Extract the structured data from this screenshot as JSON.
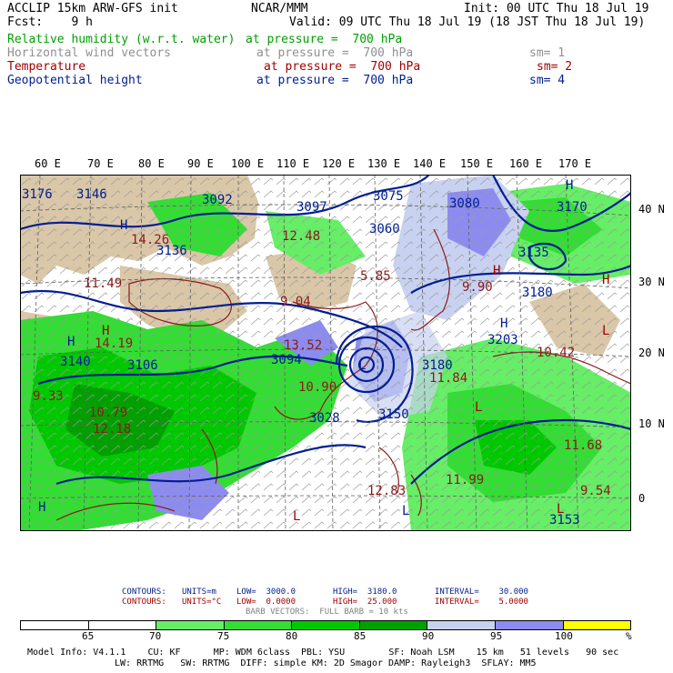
{
  "header": {
    "title": "ACCLIP 15km ARW-GFS init",
    "forecast": "Fcst:    9 h",
    "org": "NCAR/MMM",
    "init": "Init: 00 UTC Thu 18 Jul 19",
    "valid": "Valid: 09 UTC Thu 18 Jul 19 (18 JST Thu 18 Jul 19)"
  },
  "fields": [
    {
      "name": "Relative humidity (w.r.t. water)",
      "level": "at pressure =  700 hPa",
      "sm": "",
      "color": "#00a000"
    },
    {
      "name": "Horizontal wind vectors",
      "level": "at pressure =  700 hPa",
      "sm": "sm= 1",
      "color": "#909090"
    },
    {
      "name": "Temperature",
      "level": "at pressure =  700 hPa",
      "sm": "sm= 2",
      "color": "#a00000"
    },
    {
      "name": "Geopotential height",
      "level": "at pressure =  700 hPa",
      "sm": "sm= 4",
      "color": "#001e90"
    }
  ],
  "lon_labels": [
    "60 E",
    "70 E",
    "80 E",
    "90 E",
    "100 E",
    "110 E",
    "120 E",
    "130 E",
    "140 E",
    "150 E",
    "160 E",
    "170 E"
  ],
  "lat_labels": [
    "40 N",
    "30 N",
    "20 N",
    "10 N",
    "0"
  ],
  "height_labels": [
    "3176",
    "3146",
    "3092",
    "3097",
    "3075",
    "3080",
    "3060",
    "3170",
    "3136",
    "3135",
    "3180",
    "3203",
    "3094",
    "3140",
    "3106",
    "3028",
    "3150",
    "3180",
    "3153"
  ],
  "temp_labels": [
    "14.26",
    "12.48",
    "11.49",
    "9.04",
    "5.85",
    "9.90",
    "14.19",
    "13.52",
    "10.42",
    "11.84",
    "10.90",
    "10.79",
    "12.18",
    "11.68",
    "11.99",
    "9.54",
    "9.33",
    "12.83"
  ],
  "contour_info": [
    {
      "label": "CONTOURS:",
      "units": "UNITS=m",
      "low": "LOW=  3000.0",
      "high": "HIGH=  3180.0",
      "interval": "INTERVAL=    30.000",
      "color": "#001e90"
    },
    {
      "label": "CONTOURS:",
      "units": "UNITS=°C",
      "low": "LOW=  0.0000",
      "high": "HIGH=  25.000",
      "interval": "INTERVAL=    5.0000",
      "color": "#a00000"
    }
  ],
  "barb_text": "BARB VECTORS:  FULL BARB = 10 kts",
  "colorbar": {
    "labels": [
      "65",
      "70",
      "75",
      "80",
      "85",
      "90",
      "95",
      "100",
      "%"
    ],
    "colors": [
      "#ffffff",
      "#ffffff",
      "#66ee66",
      "#33dd33",
      "#00c800",
      "#00a000",
      "#c8d2f0",
      "#8c8cf0",
      "#ffff00"
    ]
  },
  "model_info": {
    "line1": "Model Info: V4.1.1    CU: KF      MP: WDM 6class  PBL: YSU        SF: Noah LSM    15 km   51 levels   90 sec",
    "line2": "LW: RRTMG   SW: RRTMG  DIFF: simple KM: 2D Smagor DAMP: Rayleigh3  SFLAY: MM5"
  }
}
